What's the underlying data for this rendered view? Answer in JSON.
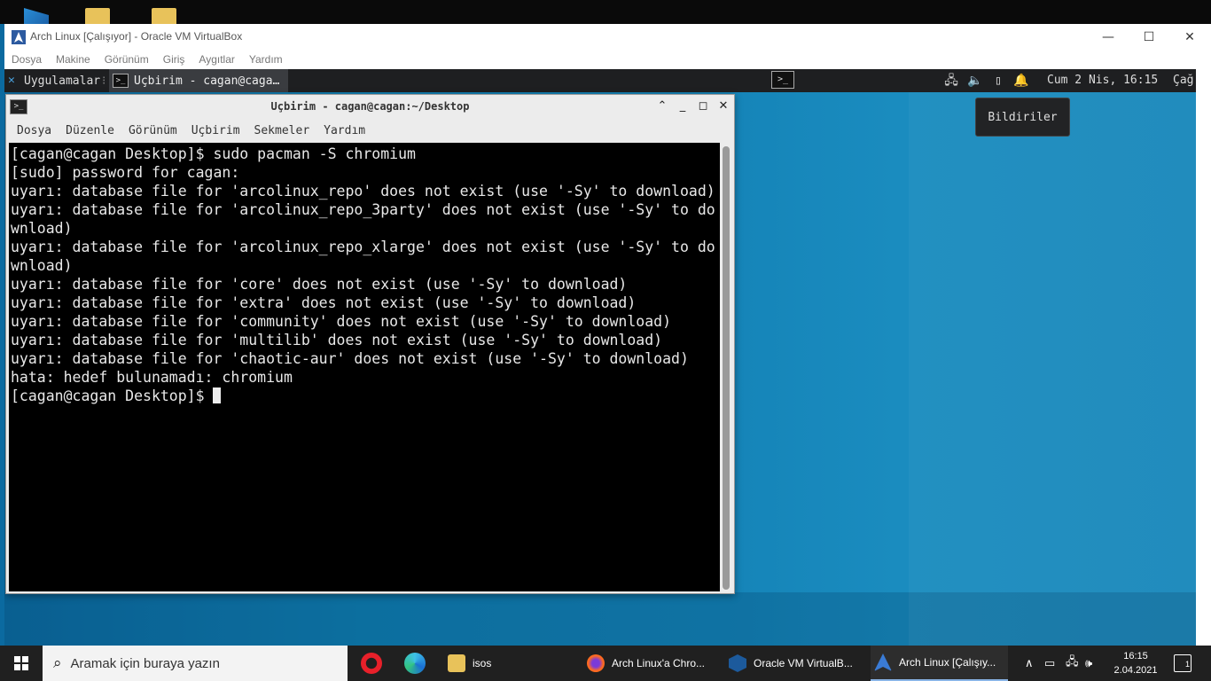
{
  "vbox": {
    "title": "Arch Linux [Çalışıyor] - Oracle VM VirtualBox",
    "menu": [
      "Dosya",
      "Makine",
      "Görünüm",
      "Giriş",
      "Aygıtlar",
      "Yardım"
    ],
    "min_glyph": "—",
    "max_glyph": "☐",
    "close_glyph": "✕"
  },
  "xfce_panel": {
    "apps_label": "Uygulamalar",
    "task_label": "Uçbirim - cagan@caga…",
    "term_glyph": ">_",
    "clock": "Cum  2 Nis, 16:15",
    "user": "Çağ",
    "tooltip": "Bildiriler"
  },
  "terminal": {
    "title": "Uçbirim - cagan@cagan:~/Desktop",
    "menu": [
      "Dosya",
      "Düzenle",
      "Görünüm",
      "Uçbirim",
      "Sekmeler",
      "Yardım"
    ],
    "lines": [
      "[cagan@cagan Desktop]$ sudo pacman -S chromium",
      "[sudo] password for cagan:",
      "uyarı: database file for 'arcolinux_repo' does not exist (use '-Sy' to download)",
      "uyarı: database file for 'arcolinux_repo_3party' does not exist (use '-Sy' to do",
      "wnload)",
      "uyarı: database file for 'arcolinux_repo_xlarge' does not exist (use '-Sy' to do",
      "wnload)",
      "uyarı: database file for 'core' does not exist (use '-Sy' to download)",
      "uyarı: database file for 'extra' does not exist (use '-Sy' to download)",
      "uyarı: database file for 'community' does not exist (use '-Sy' to download)",
      "uyarı: database file for 'multilib' does not exist (use '-Sy' to download)",
      "uyarı: database file for 'chaotic-aur' does not exist (use '-Sy' to download)",
      "hata: hedef bulunamadı: chromium"
    ],
    "prompt": "[cagan@cagan Desktop]$ "
  },
  "taskbar": {
    "search_placeholder": "Aramak için buraya yazın",
    "items": [
      {
        "label": "isos",
        "icon": "folder-icon"
      },
      {
        "label": "Arch Linux'a Chro...",
        "icon": "firefox-icon"
      },
      {
        "label": "Oracle VM VirtualB...",
        "icon": "virtualbox-icon"
      },
      {
        "label": "Arch Linux [Çalışıy...",
        "icon": "arch-vm-icon"
      }
    ],
    "time": "16:15",
    "date": "2.04.2021",
    "notif_count": "1"
  },
  "colors": {
    "panel_bg": "#1e1f21",
    "terminal_bg": "#000000",
    "desktop_accent": "#1584b8",
    "taskbar_bg": "#202020"
  }
}
